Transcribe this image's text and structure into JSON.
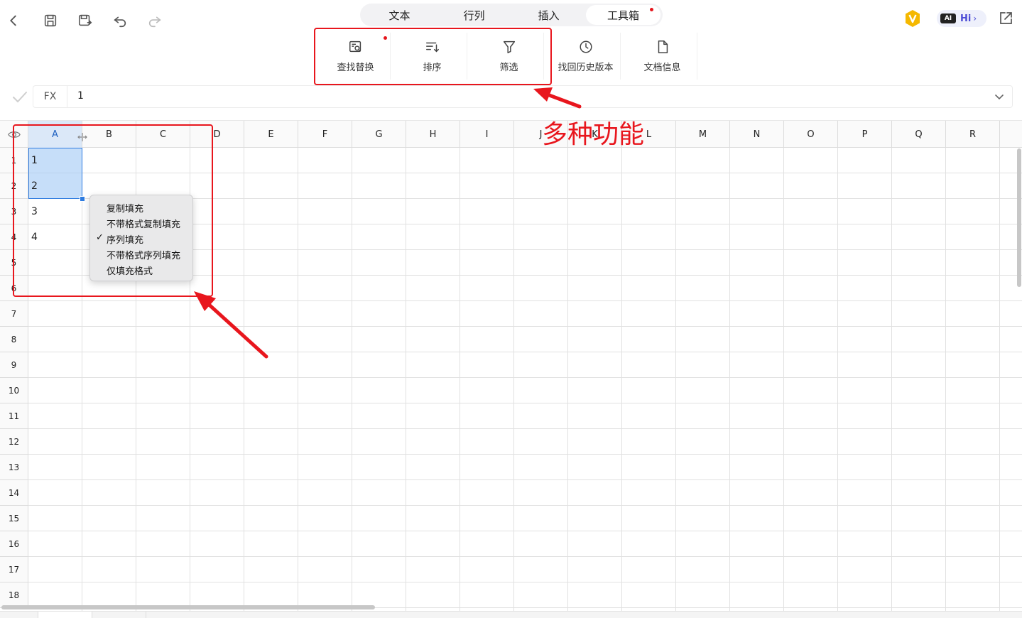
{
  "tabs": [
    {
      "label": "文本",
      "active": false,
      "dot": false
    },
    {
      "label": "行列",
      "active": false,
      "dot": false
    },
    {
      "label": "插入",
      "active": false,
      "dot": false
    },
    {
      "label": "工具箱",
      "active": true,
      "dot": true
    }
  ],
  "tools": [
    {
      "label": "查找替换",
      "icon": "find-replace-icon",
      "dot": true
    },
    {
      "label": "排序",
      "icon": "sort-icon",
      "dot": false
    },
    {
      "label": "筛选",
      "icon": "filter-icon",
      "dot": false
    },
    {
      "label": "找回历史版本",
      "icon": "history-clock-icon",
      "dot": false
    },
    {
      "label": "文档信息",
      "icon": "document-icon",
      "dot": false
    }
  ],
  "ai_button": {
    "logo": "AI",
    "label": "Hi",
    "chevron": "›"
  },
  "formula_bar": {
    "label": "FX",
    "value": "1"
  },
  "columns": [
    "A",
    "B",
    "C",
    "D",
    "E",
    "F",
    "G",
    "H",
    "I",
    "J",
    "K",
    "L",
    "M",
    "N",
    "O",
    "P",
    "Q",
    "R"
  ],
  "rows": [
    "1",
    "2",
    "3",
    "4",
    "5",
    "6",
    "7",
    "8",
    "9",
    "10",
    "11",
    "12",
    "13",
    "14",
    "15",
    "16",
    "17",
    "18"
  ],
  "cells": {
    "A1": "1",
    "A2": "2",
    "A3": "3",
    "A4": "4"
  },
  "context_menu": {
    "items": [
      {
        "label": "复制填充",
        "checked": false
      },
      {
        "label": "不带格式复制填充",
        "checked": false
      },
      {
        "label": "序列填充",
        "checked": true
      },
      {
        "label": "不带格式序列填充",
        "checked": false
      },
      {
        "label": "仅填充格式",
        "checked": false
      }
    ],
    "check_glyph": "✓"
  },
  "annotation": {
    "text": "多种功能",
    "color": "#e8161d"
  },
  "colors": {
    "accent": "#2d7be0",
    "selection": "#a0c8f5",
    "annotation": "#e8161d",
    "vip": "#f5b800",
    "ai": "#4b4bd6"
  }
}
